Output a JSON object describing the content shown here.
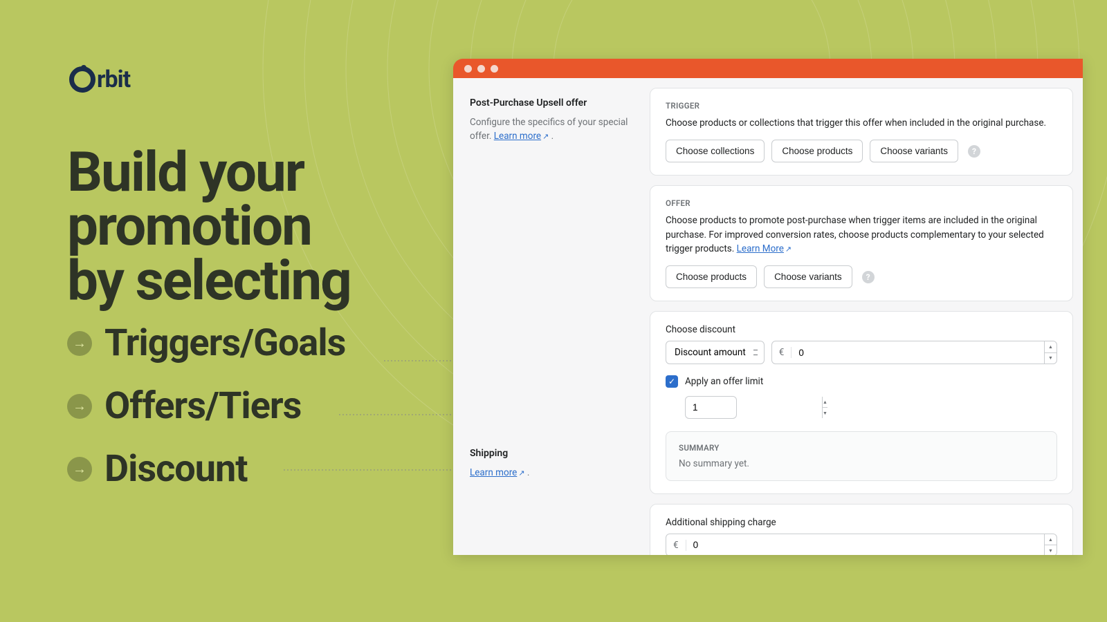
{
  "brand": {
    "name": "rbit"
  },
  "hero": {
    "line1": "Build your",
    "line2": "promotion",
    "line3": "by selecting"
  },
  "bullets": [
    {
      "label": "Triggers/Goals"
    },
    {
      "label": "Offers/Tiers"
    },
    {
      "label": "Discount"
    }
  ],
  "leftPanel": {
    "upsell": {
      "title": "Post-Purchase Upsell offer",
      "desc_prefix": "Configure the specifics of your special offer. ",
      "learn_more": "Learn more"
    },
    "shipping": {
      "title": "Shipping",
      "learn_more": "Learn more"
    }
  },
  "triggerCard": {
    "label": "TRIGGER",
    "desc": "Choose products or collections that trigger this offer when included in the original purchase.",
    "btn_collections": "Choose collections",
    "btn_products": "Choose products",
    "btn_variants": "Choose variants"
  },
  "offerCard": {
    "label": "OFFER",
    "desc_text": "Choose products to promote post-purchase when trigger items are included in the original purchase. For improved conversion rates, choose products complementary to your selected trigger products. ",
    "learn_more": "Learn More",
    "btn_products": "Choose products",
    "btn_variants": "Choose variants"
  },
  "discountCard": {
    "choose_label": "Choose discount",
    "select_value": "Discount amount",
    "currency": "€",
    "amount": "0",
    "checkbox_label": "Apply an offer limit",
    "limit_value": "1",
    "summary_label": "SUMMARY",
    "summary_text": "No summary yet."
  },
  "shippingCard": {
    "label": "Additional shipping charge",
    "currency": "€",
    "amount": "0"
  }
}
